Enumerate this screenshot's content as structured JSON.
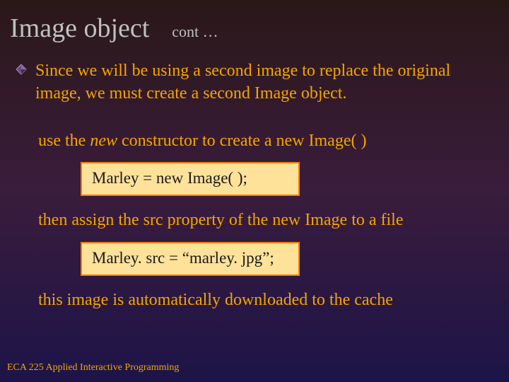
{
  "title": "Image object",
  "cont": "cont …",
  "bullet1": "Since we will be using a second image to replace the original image, we must create a second Image object.",
  "line_use_pre": "use the ",
  "line_use_em": "new",
  "line_use_post": " constructor to create a new Image( )",
  "code1": "Marley  =  new  Image( );",
  "line_then": "then assign the src property of the new Image to a file",
  "code2": "Marley. src  =  “marley. jpg”;",
  "line_cache": "this image is automatically downloaded to the cache",
  "footer": "ECA 225   Applied Interactive Programming"
}
